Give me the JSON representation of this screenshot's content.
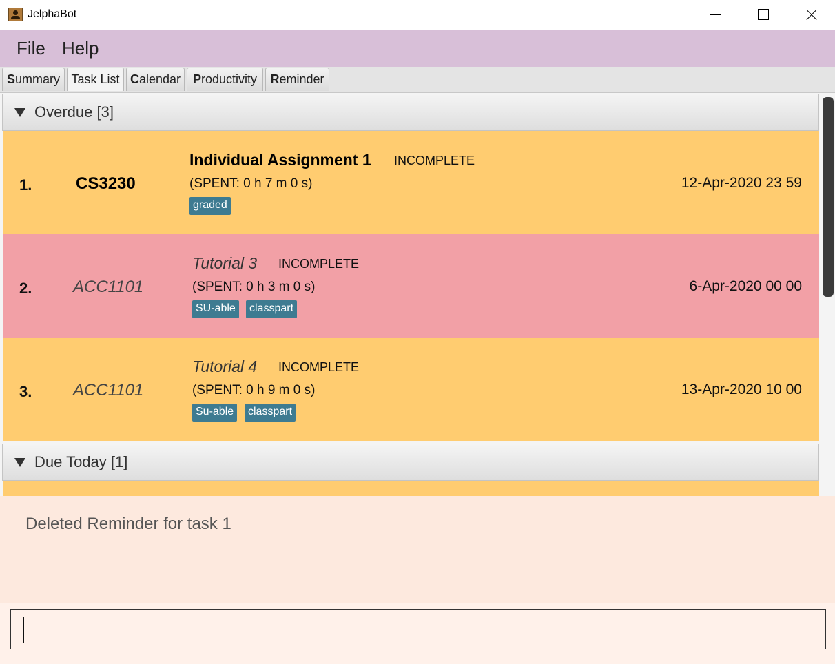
{
  "window": {
    "title": "JelphaBot"
  },
  "menu": {
    "items": [
      "File",
      "Help"
    ]
  },
  "tabs": [
    {
      "mnemonic": "S",
      "rest": "ummary"
    },
    {
      "mnemonic": "T",
      "rest": "ask List",
      "active": true
    },
    {
      "mnemonic": "C",
      "rest": "alendar"
    },
    {
      "mnemonic": "P",
      "rest": "roductivity"
    },
    {
      "mnemonic": "R",
      "rest": "eminder"
    }
  ],
  "sections": [
    {
      "title": "Overdue [3]"
    },
    {
      "title": "Due Today [1]"
    }
  ],
  "tasks": [
    {
      "index": "1.",
      "module": "CS3230",
      "description": "Individual Assignment 1",
      "status": "INCOMPLETE",
      "spent": "(SPENT: 0 h 7 m 0 s)",
      "date": "12-Apr-2020 23 59",
      "tags": [
        "graded"
      ],
      "bg_color": "#ffcc70"
    },
    {
      "index": "2.",
      "module": "ACC1101",
      "description": "Tutorial 3",
      "status": "INCOMPLETE",
      "spent": "(SPENT: 0 h 3 m 0 s)",
      "date": "6-Apr-2020 00 00",
      "tags": [
        "SU-able",
        "classpart"
      ],
      "bg_color": "#f2a0a6"
    },
    {
      "index": "3.",
      "module": "ACC1101",
      "description": "Tutorial 4",
      "status": "INCOMPLETE",
      "spent": "(SPENT: 0 h 9 m 0 s)",
      "date": "13-Apr-2020 10 00",
      "tags": [
        "Su-able",
        "classpart"
      ],
      "bg_color": "#ffcc70"
    }
  ],
  "result": {
    "text": "Deleted Reminder for task 1"
  },
  "command": {
    "value": ""
  },
  "colors": {
    "menubar": "#d8bfd8",
    "tag": "#3e7b91",
    "result_bg": "#fde9de"
  }
}
